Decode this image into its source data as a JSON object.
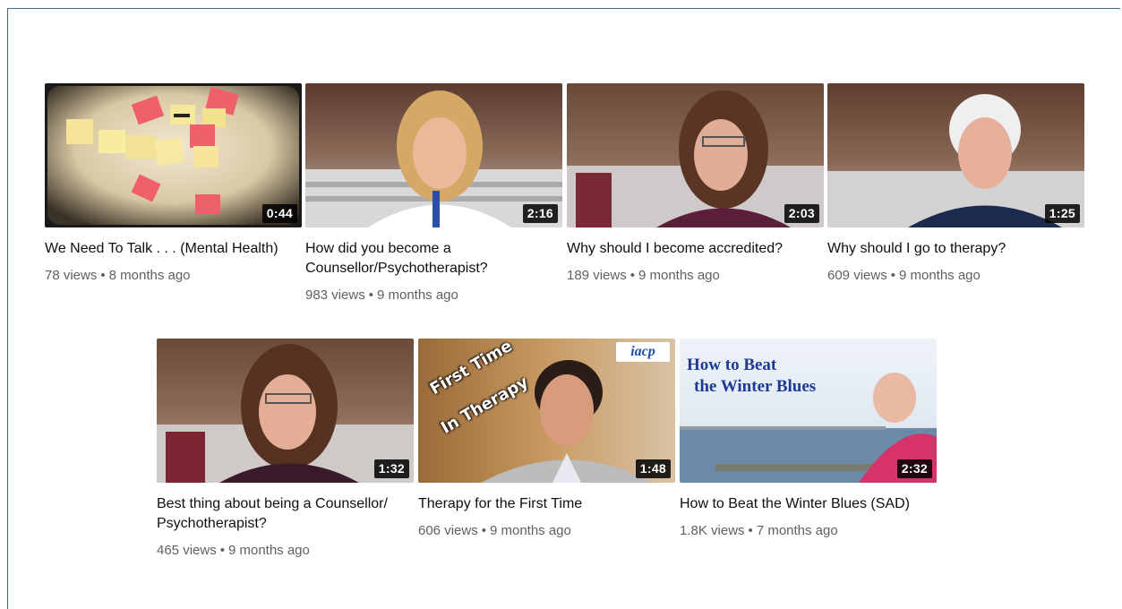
{
  "videos": [
    {
      "title": "We Need To Talk . . . (Mental Health)",
      "duration": "0:44",
      "views": "78 views",
      "age": "8 months ago"
    },
    {
      "title": "How did you become a Counsellor/Psychotherapist?",
      "duration": "2:16",
      "views": "983 views",
      "age": "9 months ago"
    },
    {
      "title": "Why should I become accredited?",
      "duration": "2:03",
      "views": "189 views",
      "age": "9 months ago"
    },
    {
      "title": "Why should I go to therapy?",
      "duration": "1:25",
      "views": "609 views",
      "age": "9 months ago"
    },
    {
      "title": "Best thing about being a Counsellor/ Psychotherapist?",
      "duration": "1:32",
      "views": "465 views",
      "age": "9 months ago"
    },
    {
      "title": "Therapy for the First Time",
      "duration": "1:48",
      "views": "606 views",
      "age": "9 months ago",
      "overlay_line1": "First Time",
      "overlay_line2": "In Therapy",
      "logo": "iacp"
    },
    {
      "title": "How to Beat the Winter Blues (SAD)",
      "duration": "2:32",
      "views": "1.8K views",
      "age": "7 months ago",
      "overlay_line1": "How to Beat",
      "overlay_line2": "the Winter Blues"
    }
  ],
  "meta_separator": "•",
  "colors": {
    "frame_border": "#2f6fa8",
    "meta_text": "#606060",
    "title_text": "#0f0f0f"
  }
}
